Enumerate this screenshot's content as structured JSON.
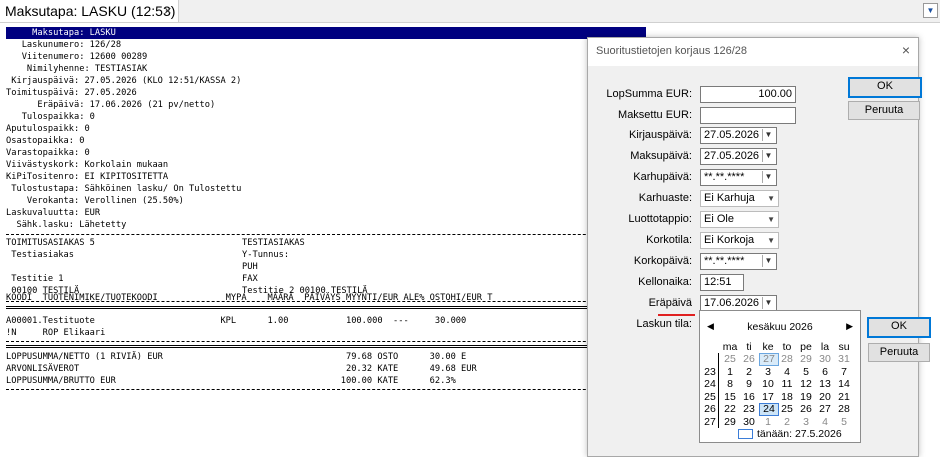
{
  "tab": {
    "title": "Maksutapa: LASKU (12:53)",
    "close": "×"
  },
  "header_lines": [
    "     Maksutapa: LASKU",
    "   Laskunumero: 126/28",
    "   Viitenumero: 12600 00289",
    "    Nimilyhenne: TESTIASIAK",
    " Kirjauspäivä: 27.05.2026 (KLO 12:51/KASSA 2)",
    "Toimituspäivä: 27.05.2026",
    "      Eräpäivä: 17.06.2026 (21 pv/netto)",
    "   Tulospaikka: 0",
    "Aputulospaikk: 0",
    "Osastopaikka: 0",
    "Varastopaikka: 0",
    "Viivästyskork: Korkolain mukaan",
    "KiPiTositenro: EI KIPITOSITETTA",
    " Tulostustapa: Sähköinen lasku/ On Tulostettu",
    "    Verokanta: Verollinen (25.50%)",
    "Laskuvaluutta: EUR",
    "  Sähk.lasku: Lähetetty"
  ],
  "address": {
    "left": [
      "TOIMITUSASIAKAS 5",
      " Testiasiakas",
      "",
      " Testitie 1",
      " 00100 TESTILÄ"
    ],
    "right": [
      "TESTIASIAKAS",
      "Y-Tunnus:",
      "PUH",
      "FAX",
      "Testitie 2 00100 TESTILÄ"
    ]
  },
  "table_header": "KOODI  TUOTENIMIKE/TUOTEKOODI             MYPA    MÄÄRÄ  PÄIVÄYS MYYNTI/EUR ALE% OSTOHI/EUR T",
  "rows": [
    "A00001.Testituote                        KPL      1.00           100.000  ---     30.000",
    "!N     ROP Elikaari"
  ],
  "totals": [
    "LOPPUSUMMA/NETTO (1 RIVIÄ) EUR                                   79.68 OSTO      30.00 E",
    "ARVONLISÄVEROT                                                   20.32 KATE      49.68 EUR",
    "LOPPUSUMMA/BRUTTO EUR                                           100.00 KATE      62.3%"
  ],
  "dialog": {
    "title": "Suoritustietojen korjaus 126/28",
    "close": "×",
    "ok": "OK",
    "cancel": "Peruuta",
    "fields": {
      "lopsumma_label": "LopSumma EUR:",
      "lopsumma_value": "100.00",
      "maksettu_label": "Maksettu EUR:",
      "maksettu_value": "",
      "kirjaus_label": "Kirjauspäivä:",
      "kirjaus_value": "27.05.2026",
      "maksu_label": "Maksupäivä:",
      "maksu_value": "27.05.2026",
      "karhu_label": "Karhupäivä:",
      "karhu_value": "**.**.****",
      "karhuaste_label": "Karhuaste:",
      "karhuaste_value": "Ei Karhuja",
      "luotto_label": "Luottotappio:",
      "luotto_value": "Ei Ole",
      "korkotila_label": "Korkotila:",
      "korkotila_value": "Ei Korkoja",
      "korkopaiva_label": "Korkopäivä:",
      "korkopaiva_value": "**.**.****",
      "kello_label": "Kellonaika:",
      "kello_value": "12:51",
      "era_label": "Eräpäivä",
      "era_value": "17.06.2026",
      "laskuntila_label": "Laskun tila:"
    }
  },
  "calendar": {
    "prev": "◀",
    "next": "▶",
    "title": "kesäkuu 2026",
    "dow": [
      "ma",
      "ti",
      "ke",
      "to",
      "pe",
      "la",
      "su"
    ],
    "weeks": [
      "",
      "23",
      "24",
      "25",
      "26",
      "27"
    ],
    "days": [
      [
        "25",
        "26",
        "27",
        "28",
        "29",
        "30",
        "31"
      ],
      [
        "1",
        "2",
        "3",
        "4",
        "5",
        "6",
        "7"
      ],
      [
        "8",
        "9",
        "10",
        "11",
        "12",
        "13",
        "14"
      ],
      [
        "15",
        "16",
        "17",
        "18",
        "19",
        "20",
        "21"
      ],
      [
        "22",
        "23",
        "24",
        "25",
        "26",
        "27",
        "28"
      ],
      [
        "29",
        "30",
        "1",
        "2",
        "3",
        "4",
        "5"
      ]
    ],
    "today_label": "tänään: 27.5.2026",
    "ok": "OK",
    "cancel": "Peruuta"
  }
}
